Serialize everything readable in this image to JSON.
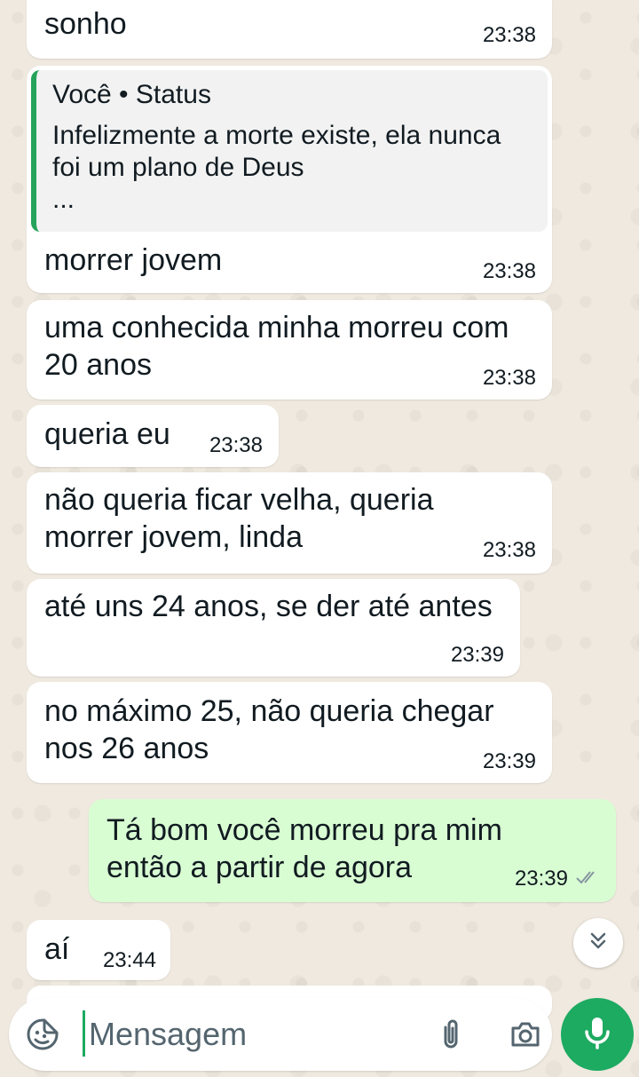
{
  "chat": {
    "messages": [
      {
        "text": "sonho",
        "time": "23:38"
      },
      {
        "quote": {
          "header": "Você • Status",
          "body": "Infelizmente a morte existe, ela nunca\nfoi um plano de Deus\n..."
        },
        "text": "morrer jovem",
        "time": "23:38"
      },
      {
        "text": "uma conhecida minha morreu com\n20 anos",
        "time": "23:38"
      },
      {
        "text": "queria eu",
        "time": "23:38"
      },
      {
        "text": "não queria ficar velha, queria\nmorrer jovem, linda",
        "time": "23:38"
      },
      {
        "text": "até uns 24 anos, se der até antes",
        "time": "23:39"
      },
      {
        "text": "no máximo 25, não queria chegar\nnos 26 anos",
        "time": "23:39"
      },
      {
        "text": "Tá bom você morreu pra mim\nentão a partir de agora",
        "time": "23:39",
        "outgoing": true,
        "status": "delivered"
      },
      {
        "text": "aí",
        "time": "23:44"
      }
    ]
  },
  "composer": {
    "placeholder": "Mensagem"
  },
  "icons": {
    "emoji": "sticker-emoji-icon",
    "attach": "paperclip-icon",
    "camera": "camera-icon",
    "mic": "microphone-icon",
    "scroll": "double-chevron-down-icon"
  },
  "colors": {
    "background": "#efe9df",
    "incoming_bubble": "#ffffff",
    "outgoing_bubble": "#d9fdd3",
    "accent": "#1daa61",
    "quote_bar": "#25a35a"
  }
}
